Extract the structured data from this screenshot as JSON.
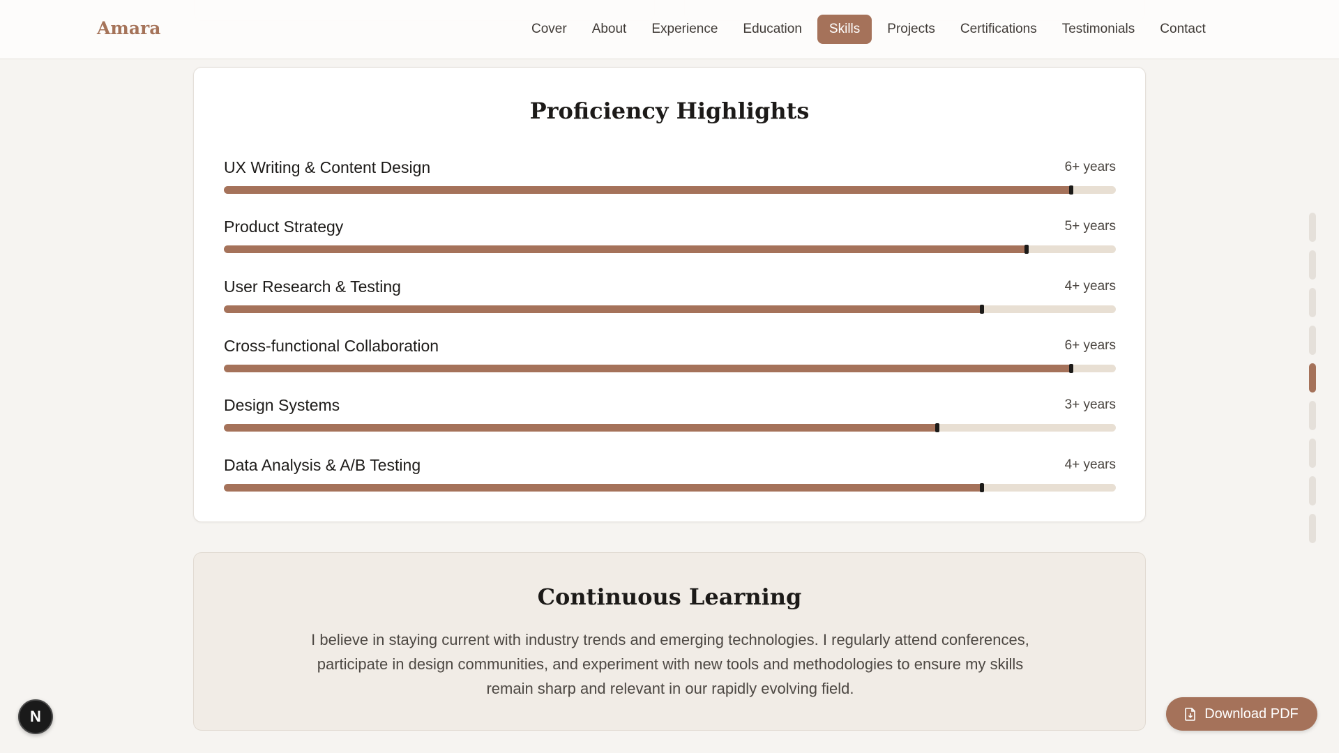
{
  "header": {
    "brand": "Amara",
    "nav": [
      {
        "label": "Cover",
        "active": false
      },
      {
        "label": "About",
        "active": false
      },
      {
        "label": "Experience",
        "active": false
      },
      {
        "label": "Education",
        "active": false
      },
      {
        "label": "Skills",
        "active": true
      },
      {
        "label": "Projects",
        "active": false
      },
      {
        "label": "Certifications",
        "active": false
      },
      {
        "label": "Testimonials",
        "active": false
      },
      {
        "label": "Contact",
        "active": false
      }
    ]
  },
  "proficiency": {
    "title": "Proficiency Highlights",
    "skills": [
      {
        "name": "UX Writing & Content Design",
        "years": "6+ years",
        "level": 0.95
      },
      {
        "name": "Product Strategy",
        "years": "5+ years",
        "level": 0.9
      },
      {
        "name": "User Research & Testing",
        "years": "4+ years",
        "level": 0.85
      },
      {
        "name": "Cross-functional Collaboration",
        "years": "6+ years",
        "level": 0.95
      },
      {
        "name": "Design Systems",
        "years": "3+ years",
        "level": 0.8
      },
      {
        "name": "Data Analysis & A/B Testing",
        "years": "4+ years",
        "level": 0.85
      }
    ]
  },
  "learning": {
    "title": "Continuous Learning",
    "text": "I believe in staying current with industry trends and emerging technologies. I regularly attend conferences, participate in design communities, and experiment with new tools and methodologies to ensure my skills remain sharp and relevant in our rapidly evolving field."
  },
  "section_indicator": {
    "count": 9,
    "active_index": 4
  },
  "fab": {
    "label": "N",
    "icon": "nextjs-icon"
  },
  "download": {
    "label": "Download PDF",
    "icon": "document-icon"
  },
  "colors": {
    "accent": "#a5725a",
    "track": "#e8dfd3",
    "background": "#f6f4f1"
  }
}
